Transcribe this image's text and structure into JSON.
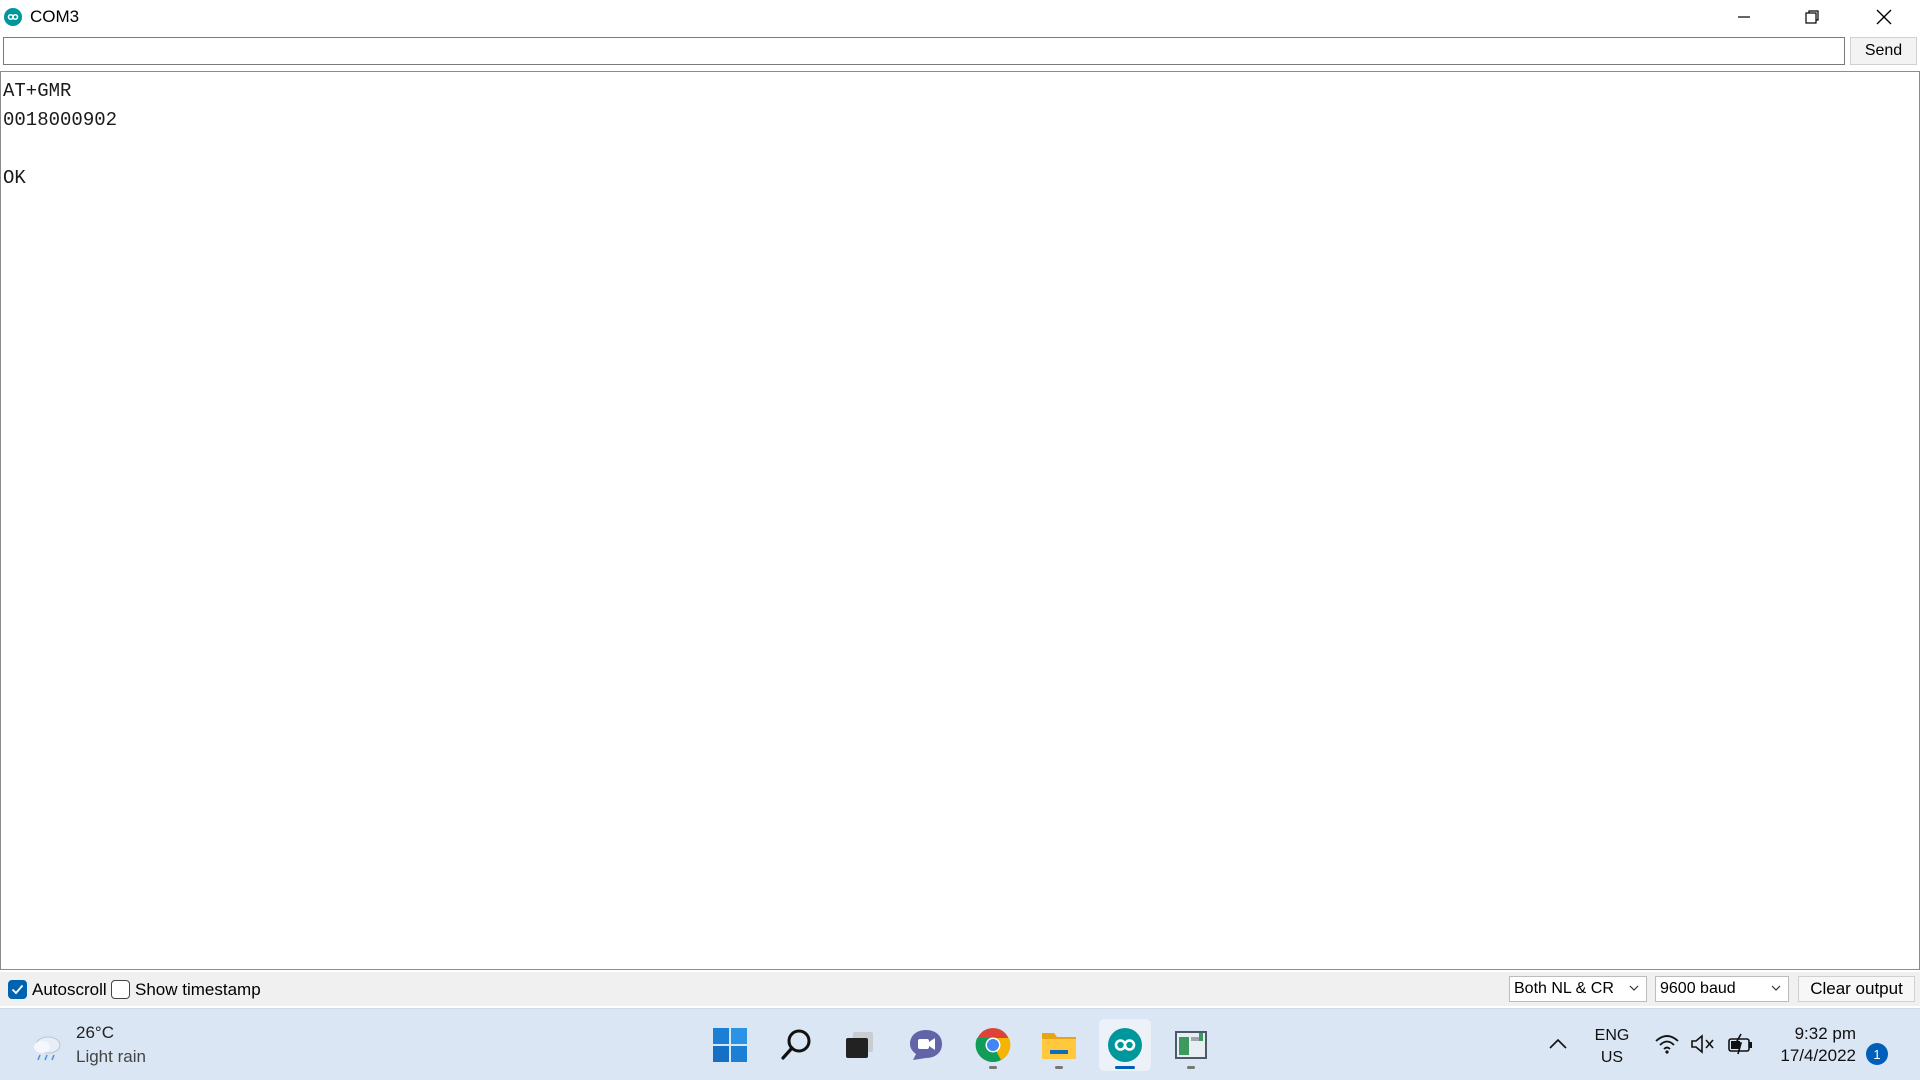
{
  "window": {
    "title": "COM3",
    "app_icon": "arduino-infinity-icon",
    "controls": [
      "minimize-icon",
      "restore-icon",
      "close-icon"
    ]
  },
  "send": {
    "input_value": "",
    "button_label": "Send"
  },
  "output": {
    "lines": [
      "AT+GMR",
      "0018000902",
      "",
      "OK"
    ]
  },
  "bottom_bar": {
    "autoscroll": {
      "label": "Autoscroll",
      "checked": true
    },
    "timestamp": {
      "label": "Show timestamp",
      "checked": false
    },
    "line_ending": "Both NL & CR",
    "baud": "9600 baud",
    "clear_label": "Clear output"
  },
  "taskbar": {
    "weather": {
      "temp": "26°C",
      "desc": "Light rain",
      "icon": "cloud-rain-icon"
    },
    "apps": [
      {
        "name": "start-icon",
        "active": false,
        "running": false
      },
      {
        "name": "search-icon",
        "active": false,
        "running": false
      },
      {
        "name": "task-view-icon",
        "active": false,
        "running": false
      },
      {
        "name": "chat-icon",
        "active": false,
        "running": false
      },
      {
        "name": "chrome-icon",
        "active": false,
        "running": true
      },
      {
        "name": "file-explorer-icon",
        "active": false,
        "running": true
      },
      {
        "name": "arduino-icon",
        "active": true,
        "running": true
      },
      {
        "name": "app-window-icon",
        "active": false,
        "running": true
      }
    ],
    "language": {
      "line1": "ENG",
      "line2": "US"
    },
    "clock": {
      "time": "9:32 pm",
      "date": "17/4/2022"
    },
    "notifications": "1"
  },
  "colors": {
    "arduino_teal": "#00979c",
    "accent_blue": "#005fb8",
    "taskbar_bg": "#dbe6f4"
  }
}
